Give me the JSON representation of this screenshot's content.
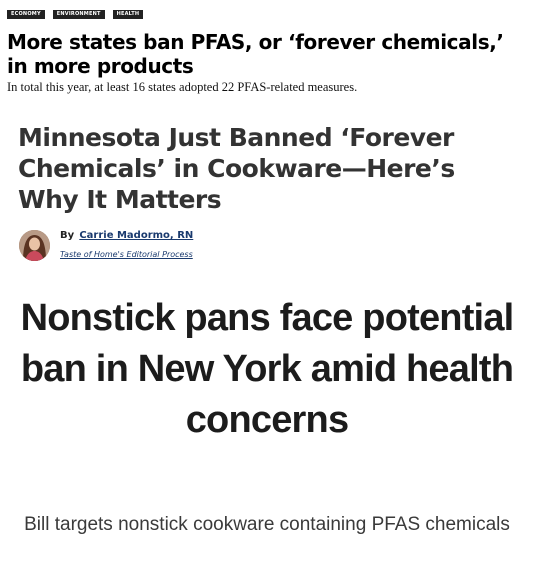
{
  "clipping1": {
    "tags": [
      "ECONOMY",
      "ENVIRONMENT",
      "HEALTH"
    ],
    "headline": "More states ban PFAS, or ‘forever chemicals,’ in more products",
    "subhead": "In total this year, at least 16 states adopted 22 PFAS-related measures."
  },
  "clipping2": {
    "headline": "Minnesota Just Banned ‘Forever Chemicals’ in Cookware—Here’s Why It Matters",
    "byline_prefix": "By",
    "author": "Carrie Madormo, RN",
    "editorial_process": "Taste of Home's Editorial Process"
  },
  "clipping3": {
    "headline": "Nonstick pans face potential ban in New York amid health concerns",
    "subhead": "Bill targets nonstick cookware containing PFAS chemicals"
  }
}
